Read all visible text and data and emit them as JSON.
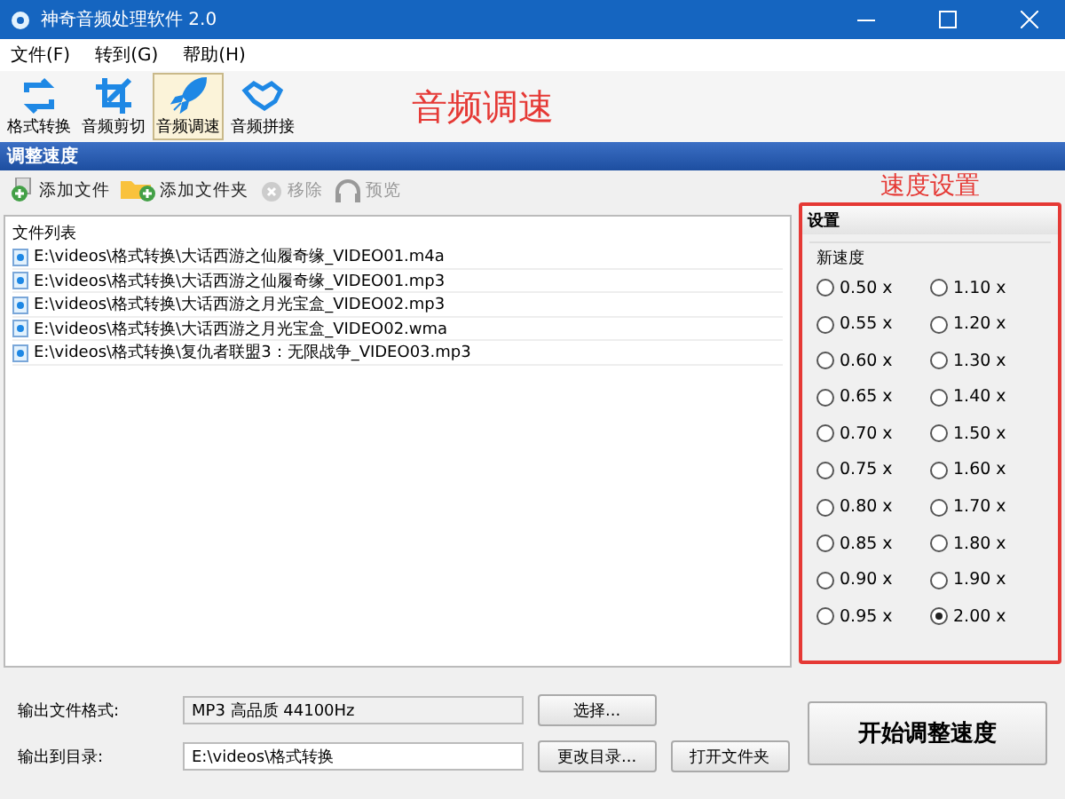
{
  "window": {
    "title": "神奇音频处理软件 2.0"
  },
  "menu": [
    "文件(F)",
    "转到(G)",
    "帮助(H)"
  ],
  "tools": [
    {
      "label": "格式转换",
      "kind": "convert",
      "selected": false
    },
    {
      "label": "音频剪切",
      "kind": "crop",
      "selected": false
    },
    {
      "label": "音频调速",
      "kind": "rocket",
      "selected": true
    },
    {
      "label": "音频拼接",
      "kind": "join",
      "selected": false
    }
  ],
  "annotation_tool": "音频调速",
  "section_title": "调整速度",
  "file_actions": [
    {
      "label": "添加文件",
      "kind": "add-file",
      "disabled": false
    },
    {
      "label": "添加文件夹",
      "kind": "add-folder",
      "disabled": false
    },
    {
      "label": "移除",
      "kind": "remove",
      "disabled": true
    },
    {
      "label": "预览",
      "kind": "preview",
      "disabled": true
    }
  ],
  "annotation_settings": "速度设置",
  "file_list": {
    "title": "文件列表",
    "files": [
      "E:\\videos\\格式转换\\大话西游之仙履奇缘_VIDEO01.m4a",
      "E:\\videos\\格式转换\\大话西游之仙履奇缘_VIDEO01.mp3",
      "E:\\videos\\格式转换\\大话西游之月光宝盒_VIDEO02.mp3",
      "E:\\videos\\格式转换\\大话西游之月光宝盒_VIDEO02.wma",
      "E:\\videos\\格式转换\\复仇者联盟3：无限战争_VIDEO03.mp3"
    ]
  },
  "settings": {
    "title": "设置",
    "group": "新速度",
    "speeds": [
      {
        "label": "0.50 x",
        "selected": false
      },
      {
        "label": "1.10 x",
        "selected": false
      },
      {
        "label": "0.55 x",
        "selected": false
      },
      {
        "label": "1.20 x",
        "selected": false
      },
      {
        "label": "0.60 x",
        "selected": false
      },
      {
        "label": "1.30 x",
        "selected": false
      },
      {
        "label": "0.65 x",
        "selected": false
      },
      {
        "label": "1.40 x",
        "selected": false
      },
      {
        "label": "0.70 x",
        "selected": false
      },
      {
        "label": "1.50 x",
        "selected": false
      },
      {
        "label": "0.75 x",
        "selected": false
      },
      {
        "label": "1.60 x",
        "selected": false
      },
      {
        "label": "0.80 x",
        "selected": false
      },
      {
        "label": "1.70 x",
        "selected": false
      },
      {
        "label": "0.85 x",
        "selected": false
      },
      {
        "label": "1.80 x",
        "selected": false
      },
      {
        "label": "0.90 x",
        "selected": false
      },
      {
        "label": "1.90 x",
        "selected": false
      },
      {
        "label": "0.95 x",
        "selected": false
      },
      {
        "label": "2.00 x",
        "selected": true
      }
    ]
  },
  "output": {
    "format_label": "输出文件格式:",
    "format_value": "MP3 高品质 44100Hz",
    "choose_button": "选择...",
    "dir_label": "输出到目录:",
    "dir_value": "E:\\videos\\格式转换",
    "change_button": "更改目录...",
    "open_button": "打开文件夹",
    "start_button": "开始调整速度"
  }
}
